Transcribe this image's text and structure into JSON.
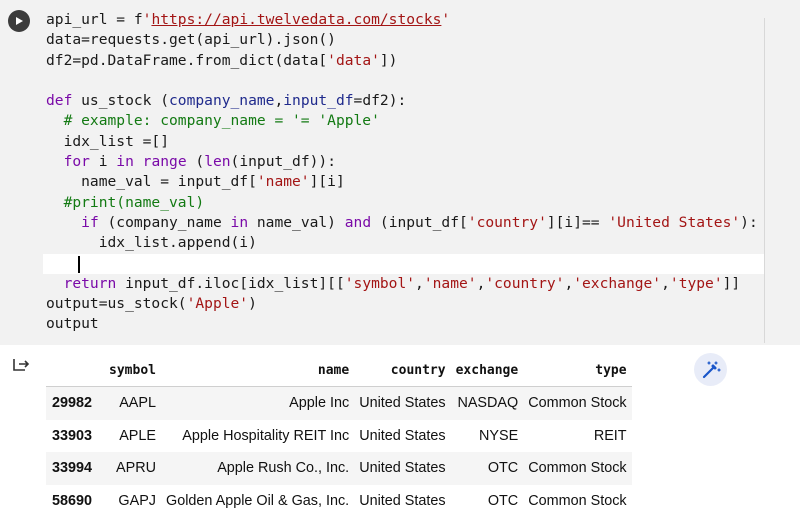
{
  "code": {
    "line1": "api_url = f'https://api.twelvedata.com/stocks'",
    "line2": "data=requests.get(api_url).json()",
    "line3": "df2=pd.DataFrame.from_dict(data['data'])",
    "line4": "",
    "line5": "def us_stock (company_name,input_df=df2):",
    "line6": "  # example: company_name = '= 'Apple'",
    "line7": "  idx_list =[]",
    "line8": "  for i in range (len(input_df)):",
    "line9": "    name_val = input_df['name'][i]",
    "line10": "  #print(name_val)",
    "line11": "    if (company_name in name_val) and (input_df['country'][i]== 'United States'):",
    "line12": "      idx_list.append(i)",
    "line13": "",
    "line14": "  return input_df.iloc[idx_list][['symbol','name','country','exchange','type']]",
    "line15": "output=us_stock('Apple')",
    "line16": "output"
  },
  "table": {
    "headers": [
      "",
      "symbol",
      "name",
      "country",
      "exchange",
      "type"
    ],
    "rows": [
      [
        "29982",
        "AAPL",
        "Apple Inc",
        "United States",
        "NASDAQ",
        "Common Stock"
      ],
      [
        "33903",
        "APLE",
        "Apple Hospitality REIT Inc",
        "United States",
        "NYSE",
        "REIT"
      ],
      [
        "33994",
        "APRU",
        "Apple Rush Co., Inc.",
        "United States",
        "OTC",
        "Common Stock"
      ],
      [
        "58690",
        "GAPJ",
        "Golden Apple Oil & Gas, Inc.",
        "United States",
        "OTC",
        "Common Stock"
      ]
    ]
  },
  "icons": {
    "run": "play-icon",
    "output": "output-arrow-icon",
    "magic": "magic-wand-icon"
  },
  "colors": {
    "string": "#a31515",
    "keyword": "#7a0aa8",
    "comment": "#137a13"
  }
}
